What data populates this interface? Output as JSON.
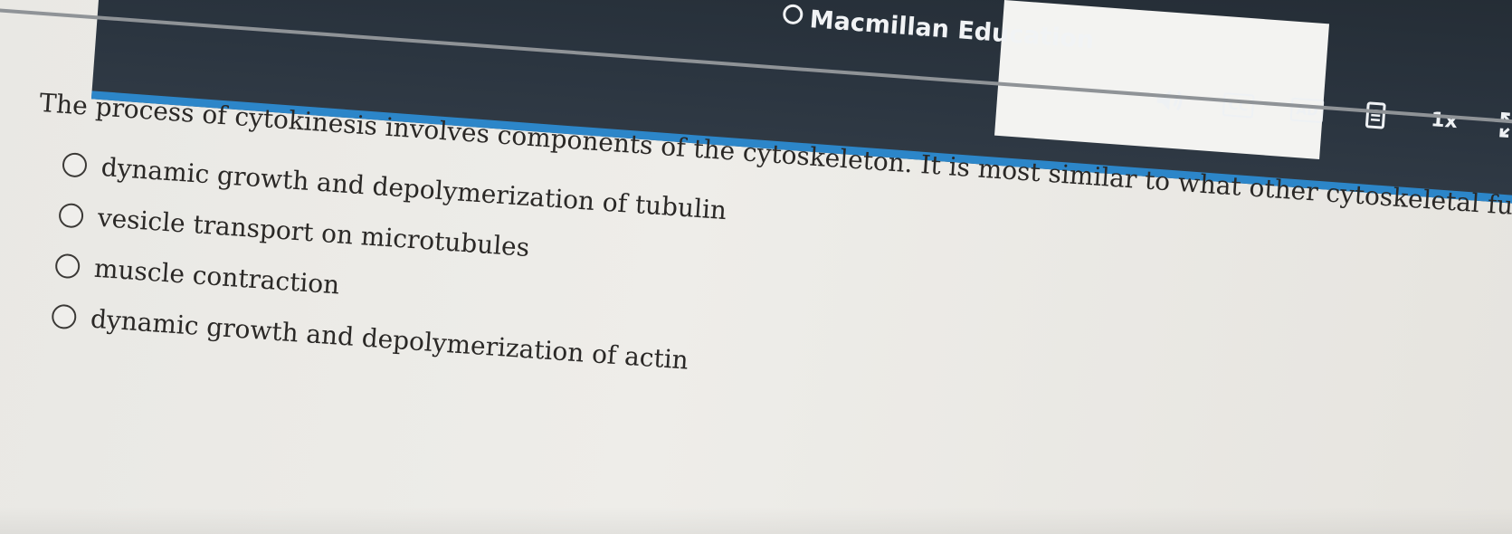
{
  "header": {
    "brand": "Macmillan Education",
    "controls": {
      "cc_label": "CC",
      "ad_label": "AD",
      "speed_label": "1x"
    },
    "icons": [
      "volume-icon",
      "closed-captions-icon",
      "audio-description-icon",
      "transcript-icon",
      "fullscreen-icon"
    ],
    "colors": {
      "player_bar": "#2b3540",
      "accent_strip": "#2c86c9"
    }
  },
  "question": {
    "text": "The process of cytokinesis involves components of the cytoskeleton. It is most similar to what other cytoskeletal function?",
    "options": [
      "dynamic growth and depolymerization of tubulin",
      "vesicle transport on microtubules",
      "muscle contraction",
      "dynamic growth and depolymerization of actin"
    ]
  }
}
